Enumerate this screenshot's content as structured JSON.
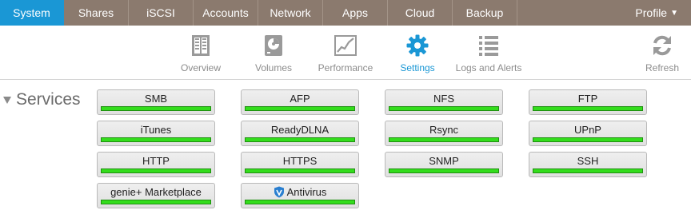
{
  "topnav": {
    "tabs": [
      "System",
      "Shares",
      "iSCSI",
      "Accounts",
      "Network",
      "Apps",
      "Cloud",
      "Backup"
    ],
    "profile_label": "Profile",
    "active_tab": "System"
  },
  "subnav": {
    "items": [
      "Overview",
      "Volumes",
      "Performance",
      "Settings",
      "Logs and Alerts"
    ],
    "refresh_label": "Refresh",
    "active_item": "Settings"
  },
  "services": {
    "title": "Services",
    "items": [
      {
        "label": "SMB",
        "enabled": true
      },
      {
        "label": "AFP",
        "enabled": true
      },
      {
        "label": "NFS",
        "enabled": true
      },
      {
        "label": "FTP",
        "enabled": true
      },
      {
        "label": "iTunes",
        "enabled": true
      },
      {
        "label": "ReadyDLNA",
        "enabled": true
      },
      {
        "label": "Rsync",
        "enabled": true
      },
      {
        "label": "UPnP",
        "enabled": true
      },
      {
        "label": "HTTP",
        "enabled": true
      },
      {
        "label": "HTTPS",
        "enabled": true
      },
      {
        "label": "SNMP",
        "enabled": true
      },
      {
        "label": "SSH",
        "enabled": true
      },
      {
        "label": "genie+ Marketplace",
        "enabled": true
      },
      {
        "label": "Antivirus",
        "enabled": true,
        "icon": "shield-icon"
      }
    ]
  },
  "colors": {
    "nav_bg": "#8b7a6e",
    "active_tab": "#1a97d5",
    "status_on": "#33dd1c",
    "icon_gray": "#9a9a9a"
  }
}
